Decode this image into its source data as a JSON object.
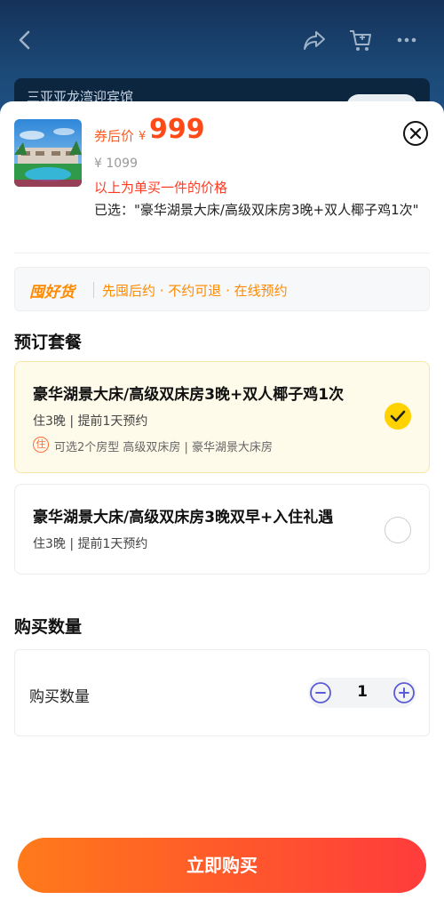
{
  "header": {
    "back_icon": "chevron-left-icon",
    "share_icon": "share-arrow-icon",
    "cart_icon": "cart-icon",
    "more_icon": "more-dots-icon",
    "hotel_title": "三亚亚龙湾迎宾馆"
  },
  "product": {
    "price_label": "券后价",
    "currency": "¥",
    "price": "999",
    "original_price": "¥ 1099",
    "price_note": "以上为单买一件的价格",
    "selected_text": "已选：\"豪华湖景大床/高级双床房3晚+双人椰子鸡1次\""
  },
  "promo": {
    "logo": "囤好货",
    "text": "先囤后约 · 不约可退 · 在线预约"
  },
  "packages": {
    "section_title": "预订套餐",
    "items": [
      {
        "name": "豪华湖景大床/高级双床房3晚+双人椰子鸡1次",
        "details": "住3晚 | 提前1天预约",
        "room_tag": "住",
        "room_options": "可选2个房型 高级双床房 | 豪华湖景大床房",
        "selected": true
      },
      {
        "name": "豪华湖景大床/高级双床房3晚双早+入住礼遇",
        "details": "住3晚 | 提前1天预约",
        "selected": false
      }
    ]
  },
  "quantity": {
    "section_title": "购买数量",
    "label": "购买数量",
    "value": "1"
  },
  "footer": {
    "buy_label": "立即购买"
  },
  "colors": {
    "accent": "#ff5a1f",
    "selected_check": "#ffd200",
    "selected_bg": "#fffbea",
    "header_bg": "#1c4a78"
  }
}
